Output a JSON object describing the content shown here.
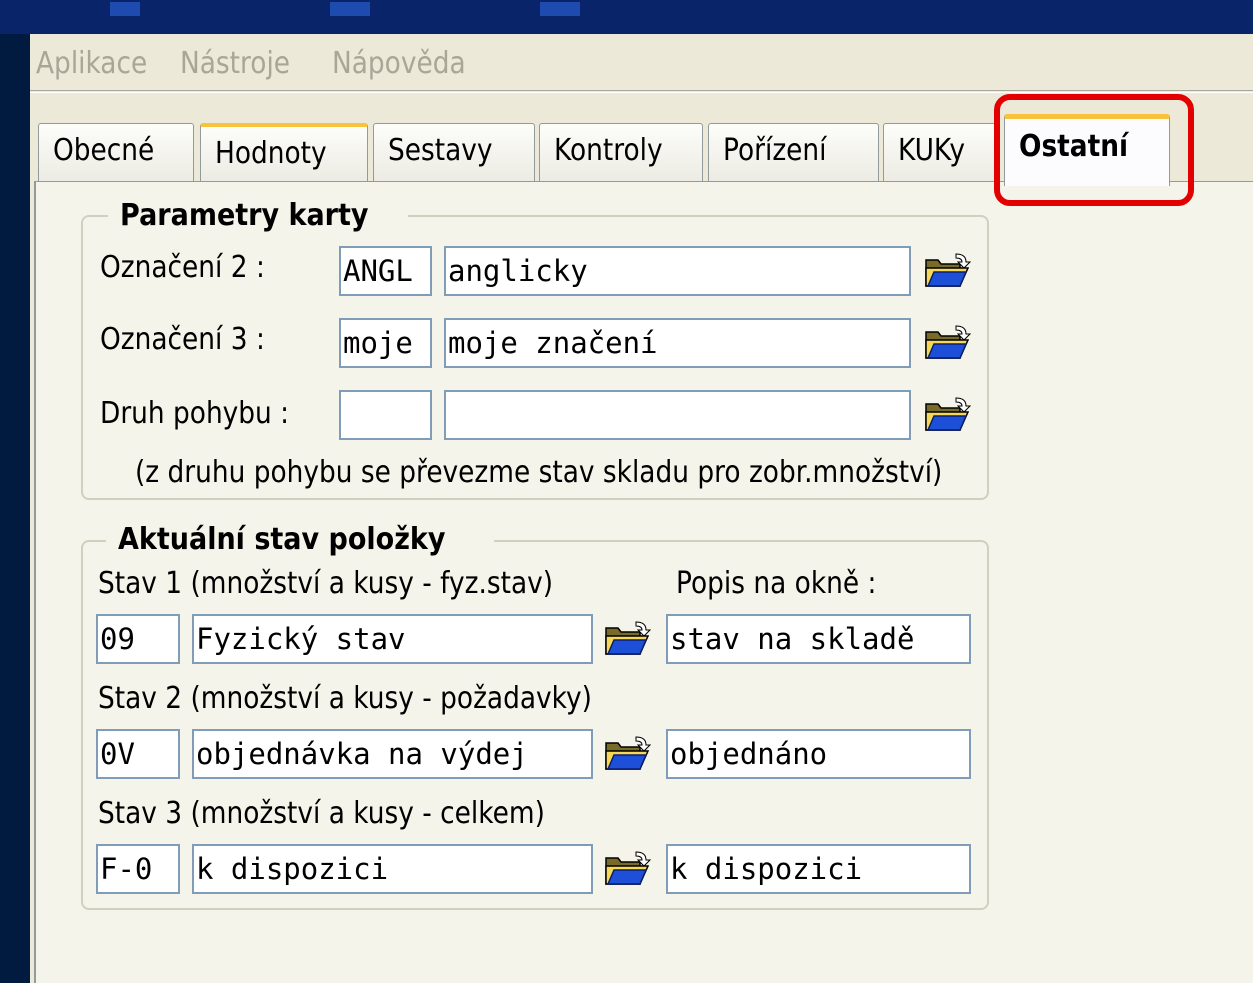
{
  "menu": [
    "Aplikace",
    "Nástroje",
    "Nápověda"
  ],
  "tabs": [
    {
      "label": "Obecné",
      "state": "normal"
    },
    {
      "label": "Hodnoty",
      "state": "hot"
    },
    {
      "label": "Sestavy",
      "state": "normal"
    },
    {
      "label": "Kontroly",
      "state": "normal"
    },
    {
      "label": "Pořízení",
      "state": "normal"
    },
    {
      "label": "KUKy",
      "state": "normal"
    },
    {
      "label": "Ostatní",
      "state": "active"
    }
  ],
  "parametry": {
    "title": "Parametry karty",
    "rows": [
      {
        "label": "Označení 2 :",
        "code": "ANGL",
        "name": "anglicky"
      },
      {
        "label": "Označení 3 :",
        "code": "moje",
        "name": "moje značení"
      },
      {
        "label": "Druh pohybu :",
        "code": "",
        "name": ""
      }
    ],
    "note": "(z druhu pohybu se převezme stav skladu pro zobr.množství)"
  },
  "stav": {
    "title": "Aktuální stav položky",
    "popis_label": "Popis na okně :",
    "rows": [
      {
        "label": "Stav 1 (množství a kusy - fyz.stav)",
        "code": "09",
        "name": "Fyzický stav",
        "popis": "stav na skladě"
      },
      {
        "label": "Stav 2 (množství a kusy - požadavky)",
        "code": "0V",
        "name": "objednávka na výdej",
        "popis": "objednáno"
      },
      {
        "label": "Stav 3 (množství a kusy - celkem)",
        "code": "F-0",
        "name": "k dispozici",
        "popis": "k dispozici"
      }
    ]
  },
  "colors": {
    "highlight": "#e20000",
    "tab_hot_accent": "#f9c23c",
    "field_border": "#7f9db9"
  },
  "icons": [
    "open-folder-icon"
  ]
}
